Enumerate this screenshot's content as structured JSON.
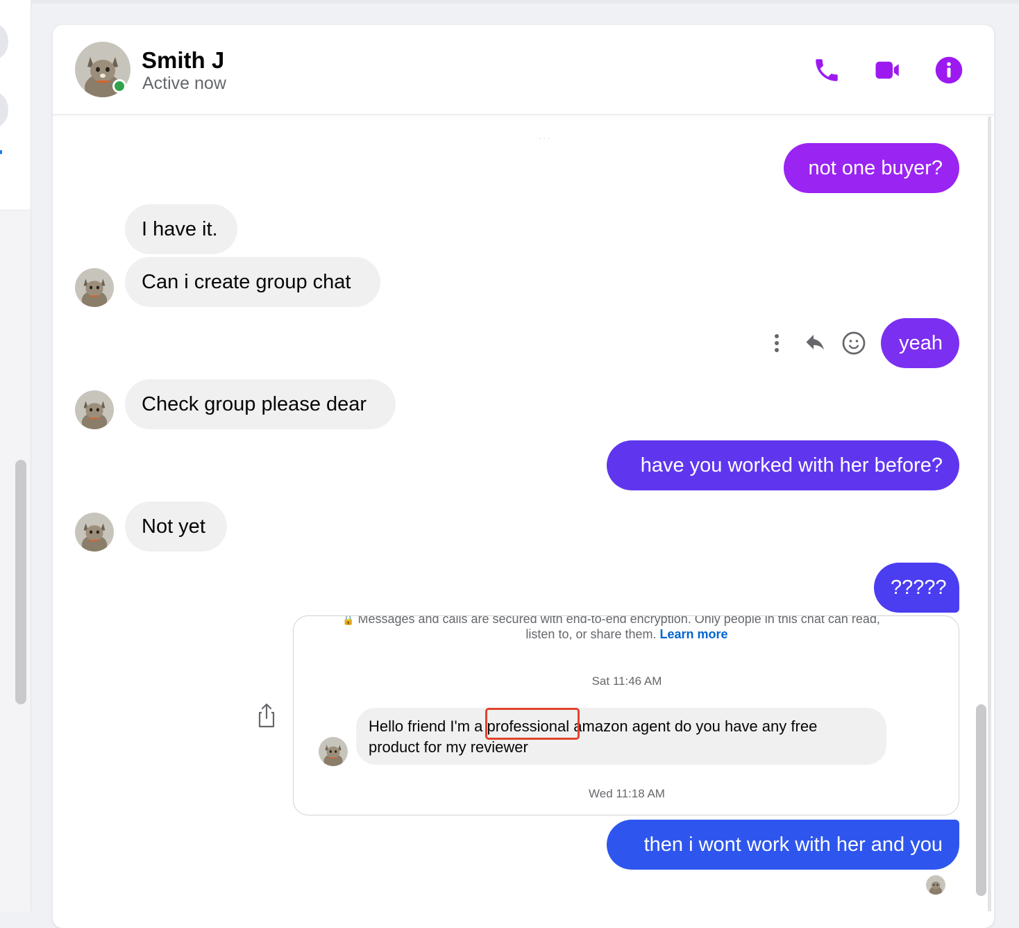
{
  "contact": {
    "name": "Smith J",
    "status": "Active now"
  },
  "header_actions": [
    "phone-icon",
    "video-camera-icon",
    "info-icon"
  ],
  "colors": {
    "accent": "#9c1af0",
    "bubble_in": "#f0f0f0",
    "out_bubble_1": "#9a24f2",
    "out_bubble_2": "#7b2ff0",
    "out_bubble_3": "#5f36ee",
    "out_bubble_4": "#4b3df0",
    "out_bubble_5": "#2e56ee",
    "highlight": "#e0432d",
    "link": "#0064d1"
  },
  "messages": {
    "m1": "not one buyer?",
    "m2": "I have it.",
    "m3": "Can i create group chat",
    "m4": "yeah",
    "m5": "Check group please dear",
    "m6": "have you worked with her before?",
    "m7": "Not yet",
    "m8": "?????",
    "m9": "then i wont work with her and you"
  },
  "message_actions": [
    "more-options-icon",
    "reply-icon",
    "react-emoji-icon"
  ],
  "shared_screenshot": {
    "encryption_line1": "Messages and calls are secured with end-to-end encryption. Only people in this chat can read,",
    "encryption_line2": "listen to, or share them.",
    "learn_more": "Learn more",
    "time_1": "Sat 11:46 AM",
    "message_line1_a": "Hello friend I'm a",
    "message_line1_highlight": "professional",
    "message_line1_b": "amazon agent do you have any free",
    "message_line2": "product for my reviewer",
    "time_2": "Wed 11:18 AM"
  }
}
